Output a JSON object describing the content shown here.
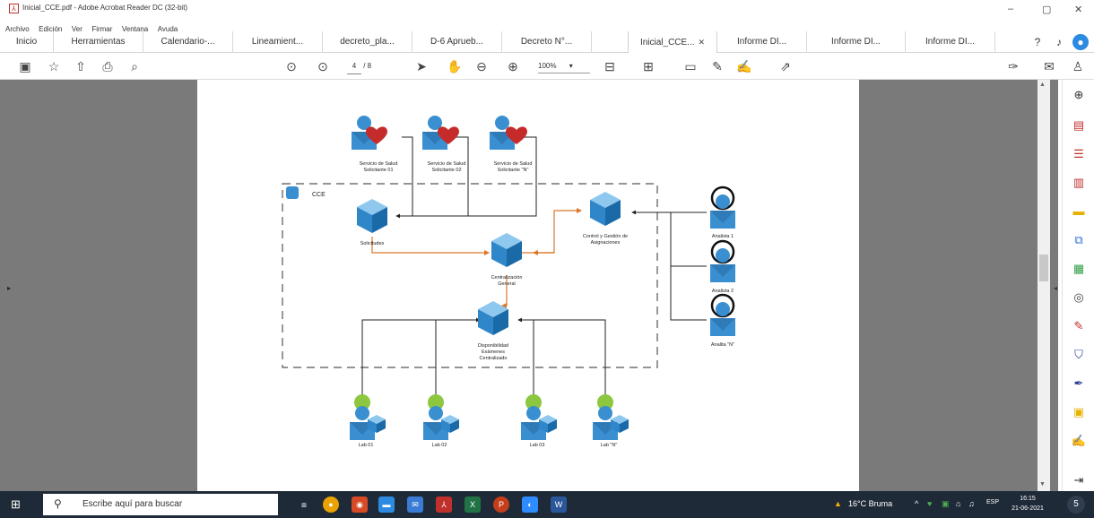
{
  "window": {
    "title": "Inicial_CCE.pdf - Adobe Acrobat Reader DC (32-bit)",
    "controls": {
      "minimize": "–",
      "maximize": "▢",
      "close": "✕"
    }
  },
  "menu": [
    "Archivo",
    "Edición",
    "Ver",
    "Firmar",
    "Ventana",
    "Ayuda"
  ],
  "tabs": [
    {
      "label": "Inicio"
    },
    {
      "label": "Herramientas"
    },
    {
      "label": "Calendario-..."
    },
    {
      "label": "Lineamient..."
    },
    {
      "label": "decreto_pla..."
    },
    {
      "label": "D-6 Aprueb..."
    },
    {
      "label": "Decreto N°..."
    },
    {
      "label": "Inicial_CCE...",
      "active": true,
      "close": "✕"
    },
    {
      "label": "Informe DI..."
    },
    {
      "label": "Informe DI..."
    },
    {
      "label": "Informe DI..."
    }
  ],
  "toolbar": {
    "page_current": "4",
    "page_total": "/ 8",
    "zoom": "100%",
    "zoom_caret": "▾",
    "right_edge_caret": "▾",
    "collapse_left": "▸",
    "collapse_right": "◂",
    "scroll_up": "▲",
    "scroll_down": "▼"
  },
  "diagram": {
    "group_label": "CCE",
    "services": [
      {
        "line1": "Servicio de Salud",
        "line2": "Solicitante 01"
      },
      {
        "line1": "Servicio de Salud",
        "line2": "Solicitante 02"
      },
      {
        "line1": "Servicio de Salud",
        "line2": "Solicitante \"N\""
      }
    ],
    "nodes": {
      "solicitudes": "Solicitudes",
      "centralizacion": [
        "Centralización",
        "General"
      ],
      "control": [
        "Control y Gestión de",
        "Asignaciones"
      ],
      "disponibilidad": [
        "Disponibilidad",
        "Exámenes",
        "Centralizado"
      ]
    },
    "analysts": [
      "Analista 1",
      "Analista 2",
      "Analita \"N\""
    ],
    "labs": [
      "Lab 01",
      "Lab 02",
      "Lab 03",
      "Lab \"N\""
    ]
  },
  "taskbar": {
    "search_placeholder": "Escribe aquí para buscar",
    "weather": "16°C Bruma",
    "tray_caret": "^",
    "language": "ESP",
    "time": "16:15",
    "date": "21-06-2021",
    "notification_count": "5"
  },
  "colors": {
    "accent_blue": "#2c8be0",
    "node_blue": "#3a8fd0",
    "arrow_orange": "#d9772a",
    "heart_red": "#c62b2b",
    "lab_green": "#8dc63f",
    "taskbar": "#1f2a38"
  }
}
